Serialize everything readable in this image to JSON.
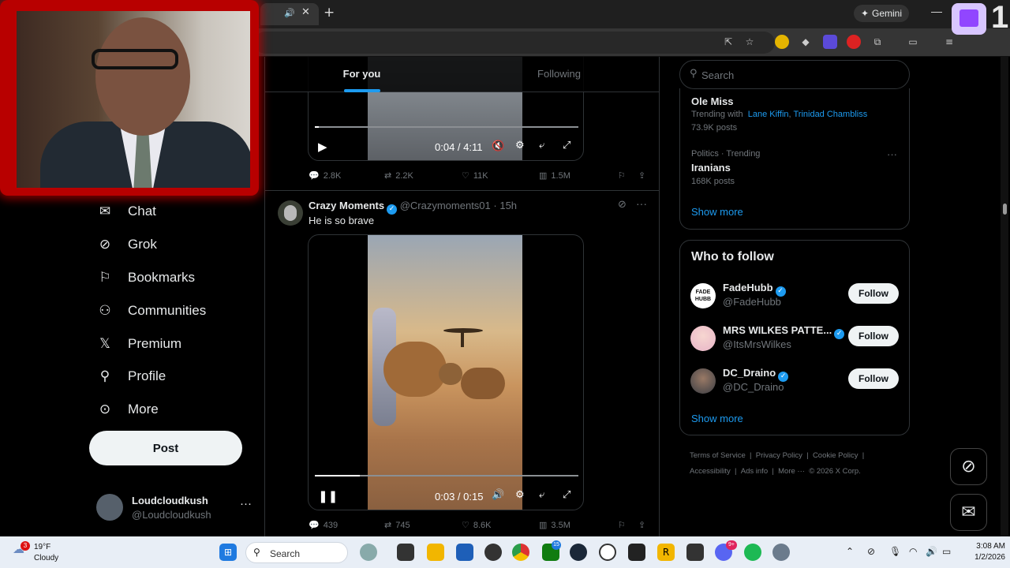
{
  "browser": {
    "new_tab": "+",
    "gemini_label": "Gemini",
    "minimize": "—"
  },
  "twitch_overlay": {
    "count": "1"
  },
  "nav": {
    "items": [
      {
        "label": "Chat",
        "icon": "mail-icon"
      },
      {
        "label": "Grok",
        "icon": "grok-icon"
      },
      {
        "label": "Bookmarks",
        "icon": "bookmark-icon"
      },
      {
        "label": "Communities",
        "icon": "communities-icon"
      },
      {
        "label": "Premium",
        "icon": "x-logo-icon"
      },
      {
        "label": "Profile",
        "icon": "person-icon"
      },
      {
        "label": "More",
        "icon": "more-circle-icon"
      }
    ],
    "post_label": "Post",
    "account_name": "Loudcloudkush",
    "account_handle": "@Loudcloudkush"
  },
  "feed": {
    "tabs": {
      "for_you": "For you",
      "following": "Following"
    },
    "tweet1": {
      "time": "0:04 / 4:11",
      "progress": 0.016,
      "replies": "2.8K",
      "reposts": "2.2K",
      "likes": "11K",
      "views": "1.5M"
    },
    "tweet2": {
      "author": "Crazy Moments",
      "handle": "@Crazymoments01",
      "age": "· 15h",
      "text": "He is so brave",
      "time": "0:03 / 0:15",
      "progress": 0.17,
      "replies": "439",
      "reposts": "745",
      "likes": "8.6K",
      "views": "3.5M"
    }
  },
  "sidebar": {
    "search_placeholder": "Search",
    "trends": [
      {
        "title": "Ole Miss",
        "trending_with": "Trending with",
        "related_1": "Lane Kiffin",
        "related_2": "Trinidad Chambliss",
        "posts": "73.9K posts"
      },
      {
        "context": "Politics · Trending",
        "title": "Iranians",
        "posts": "168K posts"
      }
    ],
    "show_more": "Show more",
    "who_to_follow": "Who to follow",
    "follow_suggestions": [
      {
        "name": "FadeHubb",
        "handle": "@FadeHubb",
        "button": "Follow",
        "avatar_text": "FADE HUBB"
      },
      {
        "name": "MRS WILKES PATTE...",
        "handle": "@ItsMrsWilkes",
        "button": "Follow"
      },
      {
        "name": "DC_Draino",
        "handle": "@DC_Draino",
        "button": "Follow"
      }
    ],
    "show_more_2": "Show more",
    "footer": [
      "Terms of Service",
      "|",
      "Privacy Policy",
      "|",
      "Cookie Policy",
      "|",
      "Accessibility",
      "|",
      "Ads info",
      "|",
      "More ···",
      "© 2026 X Corp."
    ]
  },
  "taskbar": {
    "weather_temp": "19°F",
    "weather_desc": "Cloudy",
    "weather_badge": "3",
    "search_label": "Search",
    "xbox_badge": "15",
    "discord_badge": "9+",
    "time": "3:08 AM",
    "date": "1/2/2026"
  },
  "colors": {
    "accent": "#1d9bf0",
    "twitch": "#9146ff",
    "cam_border": "#b80000"
  }
}
